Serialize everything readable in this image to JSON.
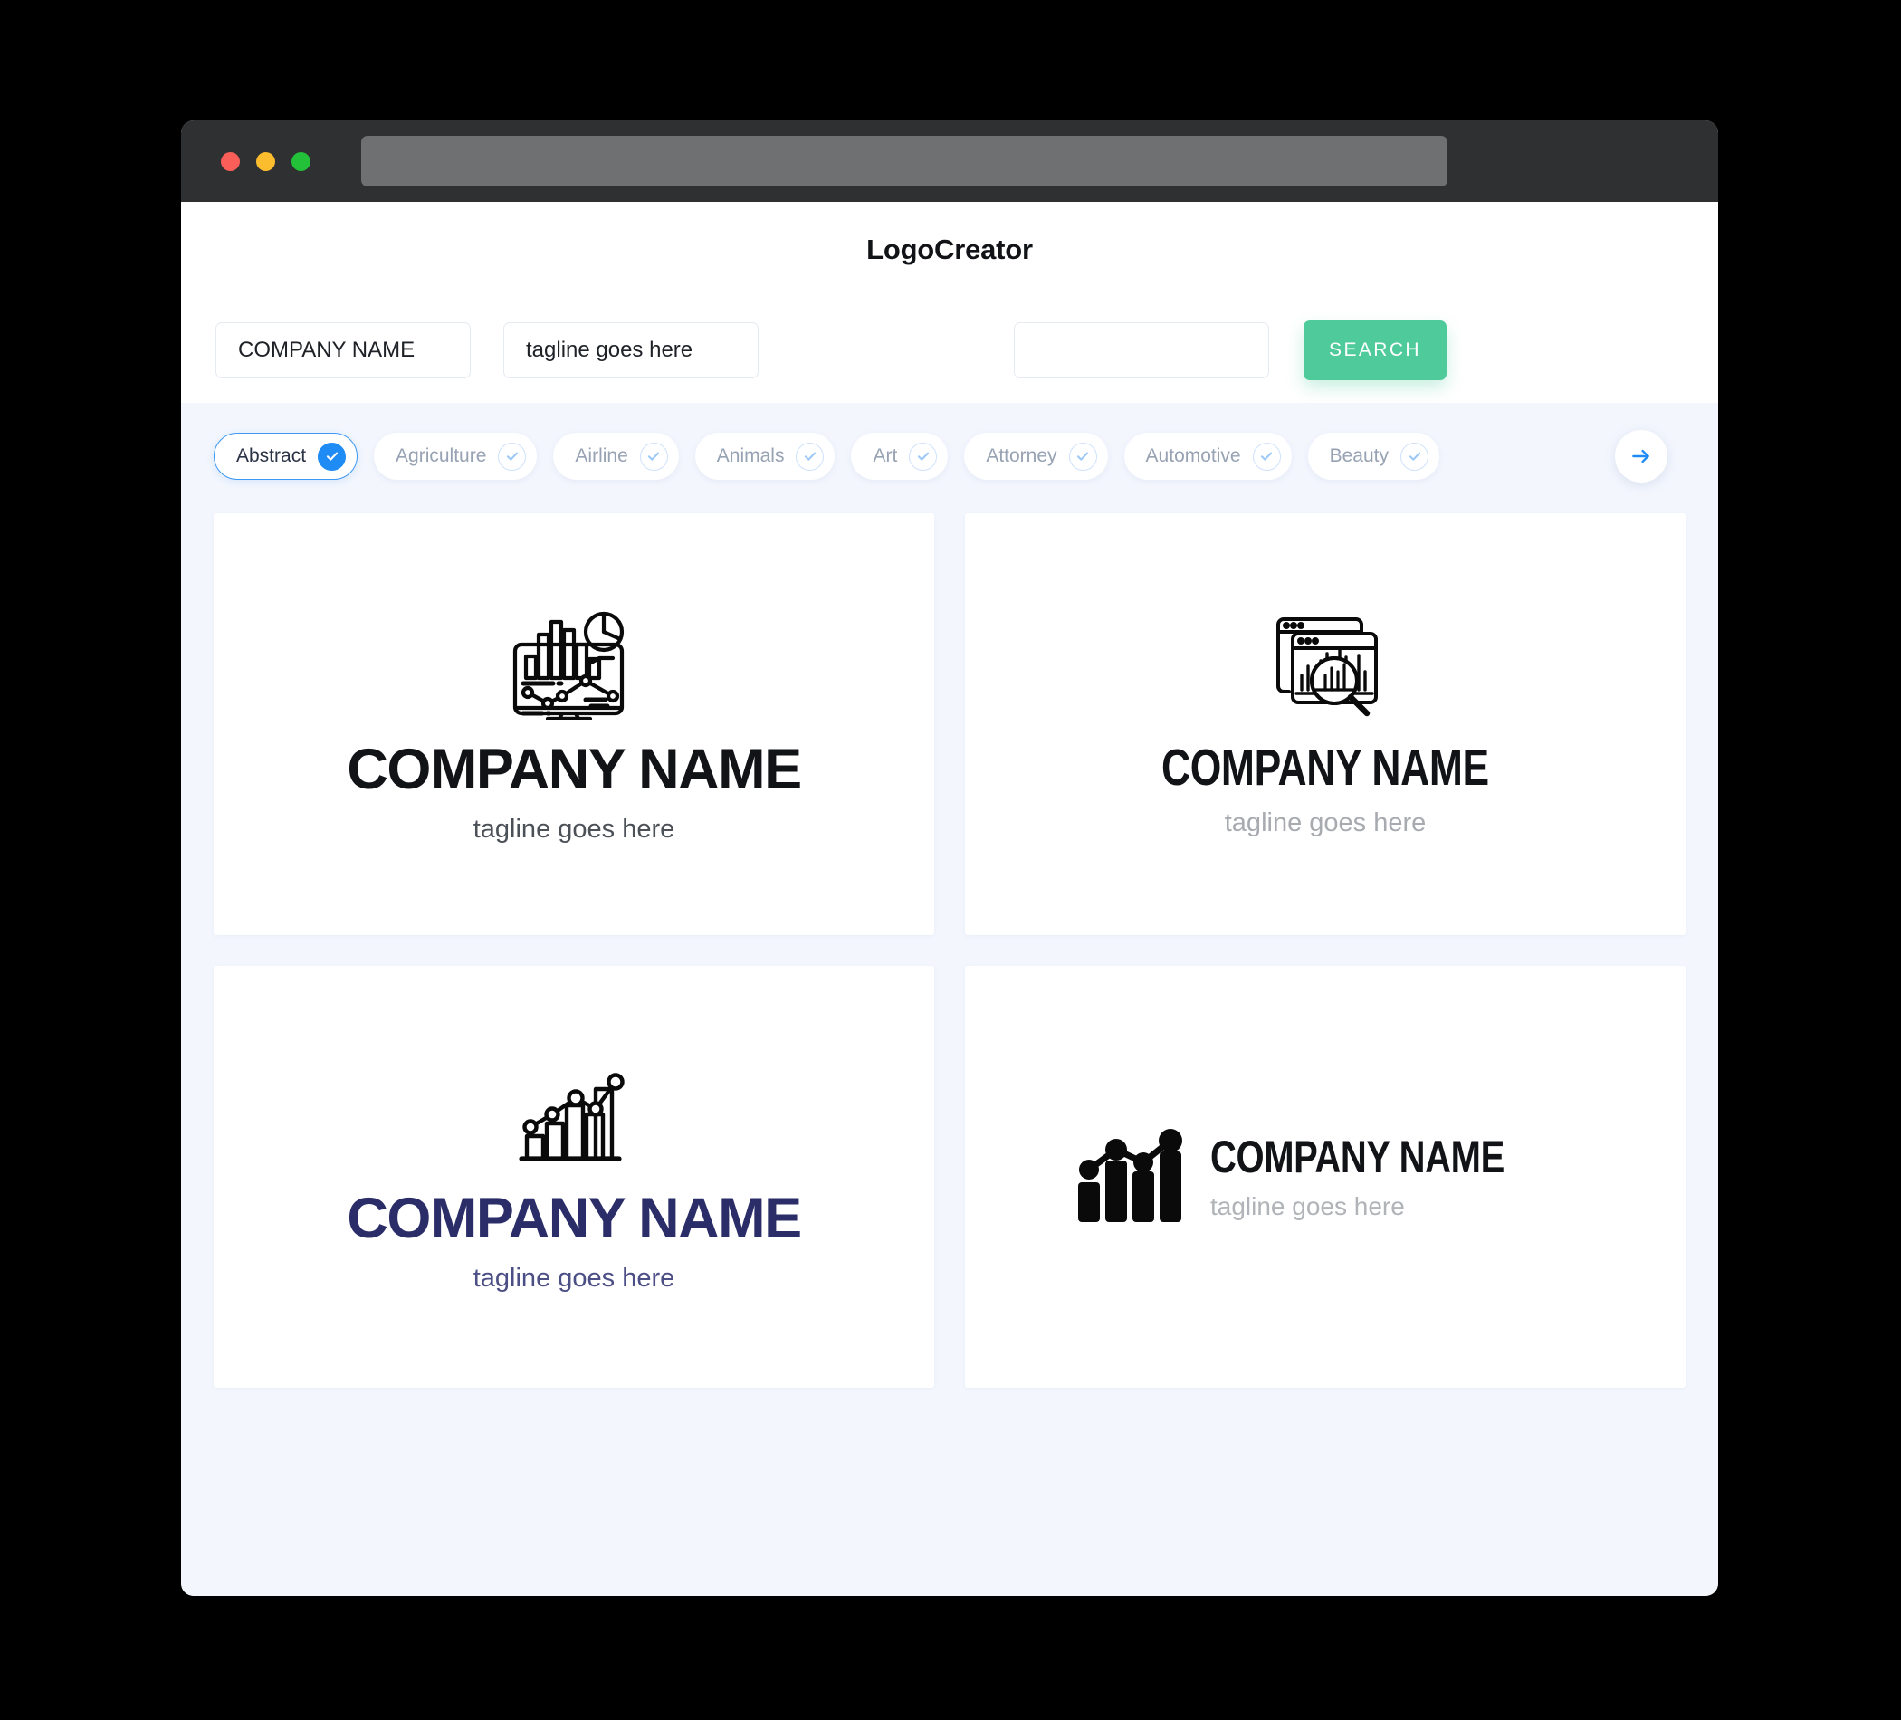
{
  "window": {
    "traffic_lights": [
      "close",
      "minimize",
      "maximize"
    ],
    "url_value": ""
  },
  "header": {
    "app_title": "LogoCreator"
  },
  "search": {
    "company_value": "COMPANY NAME",
    "company_placeholder": "COMPANY NAME",
    "tagline_value": "tagline goes here",
    "tagline_placeholder": "tagline goes here",
    "extra_value": "",
    "extra_placeholder": "",
    "search_label": "SEARCH"
  },
  "categories": {
    "next_icon": "arrow-right-icon",
    "items": [
      {
        "label": "Abstract",
        "selected": true
      },
      {
        "label": "Agriculture",
        "selected": false
      },
      {
        "label": "Airline",
        "selected": false
      },
      {
        "label": "Animals",
        "selected": false
      },
      {
        "label": "Art",
        "selected": false
      },
      {
        "label": "Attorney",
        "selected": false
      },
      {
        "label": "Automotive",
        "selected": false
      },
      {
        "label": "Beauty",
        "selected": false
      }
    ]
  },
  "results": [
    {
      "icon": "monitor-analytics-icon",
      "name": "COMPANY NAME",
      "tagline": "tagline goes here",
      "name_color": "#111317",
      "tagline_color": "#4c5158",
      "layout": "stacked"
    },
    {
      "icon": "browser-chart-search-icon",
      "name": "COMPANY NAME",
      "tagline": "tagline goes here",
      "name_color": "#111317",
      "tagline_color": "#a7abb0",
      "layout": "stacked"
    },
    {
      "icon": "growth-bars-line-icon",
      "name": "COMPANY NAME",
      "tagline": "tagline goes here",
      "name_color": "#2a2d68",
      "tagline_color": "#4c4f85",
      "layout": "stacked"
    },
    {
      "icon": "solid-bars-dots-icon",
      "name": "COMPANY NAME",
      "tagline": "tagline goes here",
      "name_color": "#111317",
      "tagline_color": "#b0b3b7",
      "layout": "horizontal"
    }
  ],
  "colors": {
    "page_background": "#000000",
    "app_background": "#f3f6fd",
    "titlebar": "#2f3031",
    "accent_green": "#4fcb9b",
    "accent_blue": "#1f8cf5",
    "chip_text": "#97a2b3",
    "navy": "#2a2d68"
  }
}
